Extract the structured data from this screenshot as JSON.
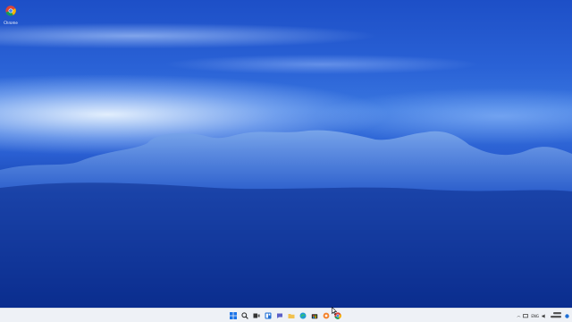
{
  "desktop": {
    "icons": [
      {
        "label": "Chrome",
        "icon": "chrome-icon"
      }
    ]
  },
  "taskbar": {
    "apps": [
      {
        "name": "start",
        "icon": "windows-logo-icon"
      },
      {
        "name": "search",
        "icon": "search-icon"
      },
      {
        "name": "task-view",
        "icon": "task-view-icon"
      },
      {
        "name": "widgets",
        "icon": "widgets-icon"
      },
      {
        "name": "chat",
        "icon": "chat-icon"
      },
      {
        "name": "file-explorer",
        "icon": "folder-icon"
      },
      {
        "name": "edge",
        "icon": "edge-icon"
      },
      {
        "name": "store",
        "icon": "store-icon"
      },
      {
        "name": "app-orange",
        "icon": "app-icon"
      },
      {
        "name": "chrome",
        "icon": "chrome-icon"
      }
    ],
    "tray": {
      "language": "ENG"
    }
  },
  "colors": {
    "taskbar_bg": "#eef1f6",
    "wallpaper_deep": "#0b2c88",
    "wallpaper_light": "#e6f0ff"
  }
}
